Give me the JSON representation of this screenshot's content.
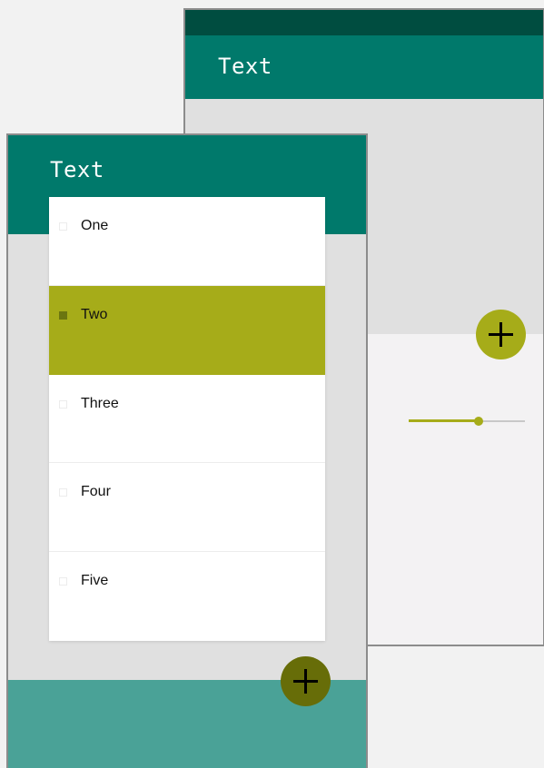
{
  "back_window": {
    "title": "Text",
    "fab": {
      "icon": "plus-icon"
    },
    "slider": {
      "value": 0.6
    }
  },
  "front_window": {
    "title": "Text",
    "list": {
      "items": [
        {
          "label": "One",
          "selected": false
        },
        {
          "label": "Two",
          "selected": true
        },
        {
          "label": "Three",
          "selected": false
        },
        {
          "label": "Four",
          "selected": false
        },
        {
          "label": "Five",
          "selected": false
        }
      ]
    },
    "fab": {
      "icon": "plus-icon"
    }
  },
  "colors": {
    "primary": "#00796b",
    "primary_dark": "#004d40",
    "accent": "#a6ac19",
    "accent_dark": "#676d08",
    "bottom_band": "#4aa297"
  }
}
